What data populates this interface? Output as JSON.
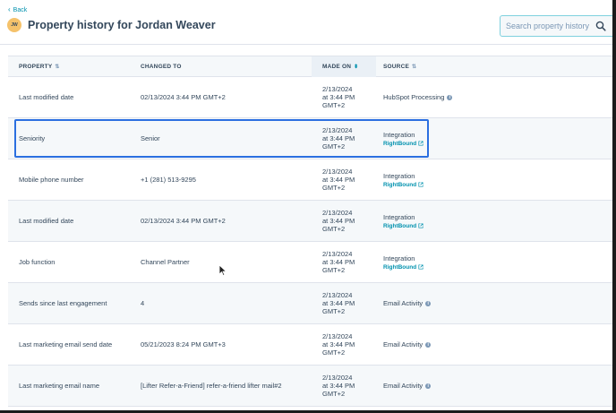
{
  "header": {
    "back_label": "Back",
    "avatar_initials": "JW",
    "title": "Property history for Jordan Weaver",
    "search_placeholder": "Search property history"
  },
  "table": {
    "columns": [
      {
        "label": "PROPERTY"
      },
      {
        "label": "CHANGED TO"
      },
      {
        "label": "MADE ON"
      },
      {
        "label": "SOURCE"
      }
    ],
    "rows": [
      {
        "property": "Last modified date",
        "changed_to": "02/13/2024 3:44 PM GMT+2",
        "made_on": [
          "2/13/2024",
          "at 3:44 PM",
          "GMT+2"
        ],
        "source": "HubSpot Processing",
        "source_link": ""
      },
      {
        "property": "Seniority",
        "changed_to": "Senior",
        "made_on": [
          "2/13/2024",
          "at 3:44 PM",
          "GMT+2"
        ],
        "source": "Integration",
        "source_link": "RightBound"
      },
      {
        "property": "Mobile phone number",
        "changed_to": "+1 (281) 513-9295",
        "made_on": [
          "2/13/2024",
          "at 3:44 PM",
          "GMT+2"
        ],
        "source": "Integration",
        "source_link": "RightBound"
      },
      {
        "property": "Last modified date",
        "changed_to": "02/13/2024 3:44 PM GMT+2",
        "made_on": [
          "2/13/2024",
          "at 3:44 PM",
          "GMT+2"
        ],
        "source": "Integration",
        "source_link": "RightBound"
      },
      {
        "property": "Job function",
        "changed_to": "Channel Partner",
        "made_on": [
          "2/13/2024",
          "at 3:44 PM",
          "GMT+2"
        ],
        "source": "Integration",
        "source_link": "RightBound"
      },
      {
        "property": "Sends since last engagement",
        "changed_to": "4",
        "made_on": [
          "2/13/2024",
          "at 3:44 PM",
          "GMT+2"
        ],
        "source": "Email Activity",
        "source_link": ""
      },
      {
        "property": "Last marketing email send date",
        "changed_to": "05/21/2023 8:24 PM GMT+3",
        "made_on": [
          "2/13/2024",
          "at 3:44 PM",
          "GMT+2"
        ],
        "source": "Email Activity",
        "source_link": ""
      },
      {
        "property": "Last marketing email name",
        "changed_to": "[Lifter Refer-a-Friend] refer-a-friend lifter mail#2",
        "made_on": [
          "2/13/2024",
          "at 3:44 PM",
          "GMT+2"
        ],
        "source": "Email Activity",
        "source_link": ""
      }
    ]
  },
  "colors": {
    "accent": "#0091ae",
    "highlight": "#2b6fe0",
    "text": "#33475b"
  }
}
